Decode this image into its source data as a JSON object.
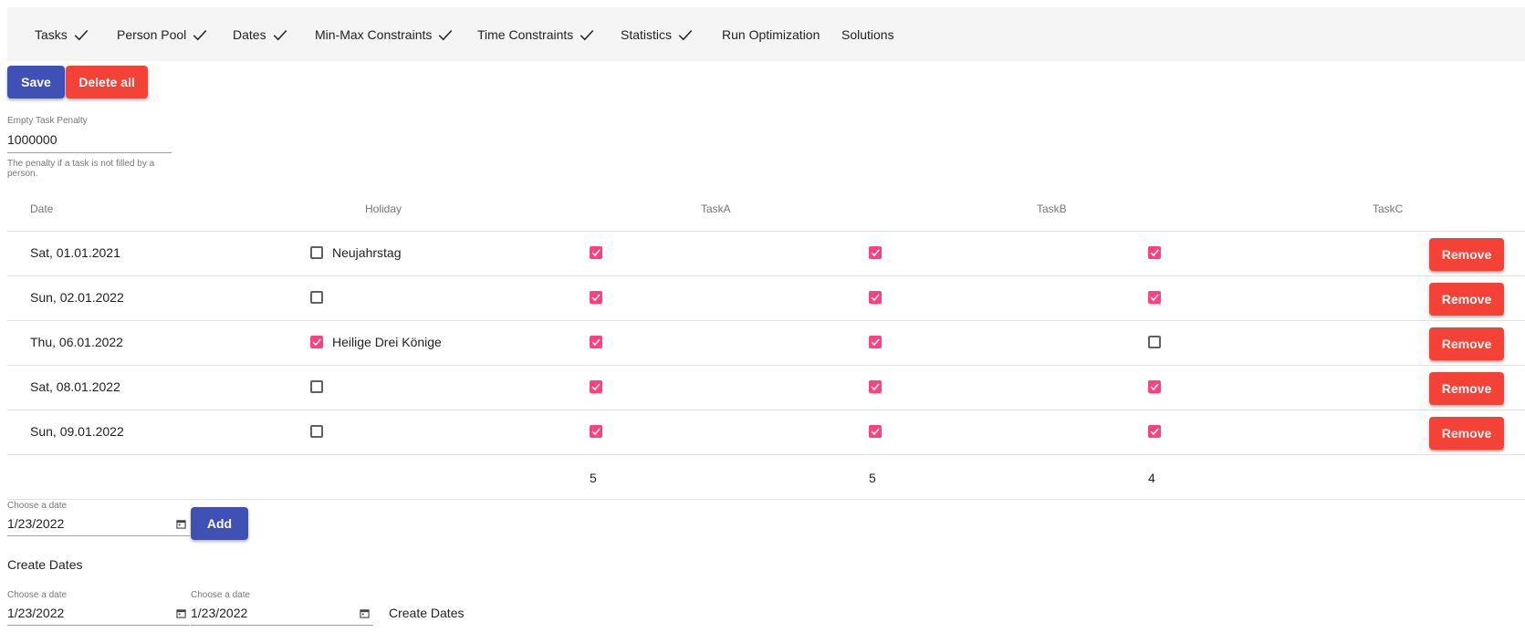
{
  "nav": {
    "items": [
      {
        "label": "Tasks",
        "done": true
      },
      {
        "label": "Person Pool",
        "done": true
      },
      {
        "label": "Dates",
        "done": true
      },
      {
        "label": "Min-Max Constraints",
        "done": true
      },
      {
        "label": "Time Constraints",
        "done": true
      },
      {
        "label": "Statistics",
        "done": true
      },
      {
        "label": "Run Optimization",
        "done": false
      },
      {
        "label": "Solutions",
        "done": false
      }
    ]
  },
  "toolbar": {
    "save_label": "Save",
    "delete_all_label": "Delete all"
  },
  "penalty": {
    "label": "Empty Task Penalty",
    "value": "1000000",
    "hint": "The penalty if a task is not filled by a person."
  },
  "table": {
    "headers": {
      "date": "Date",
      "holiday": "Holiday",
      "task_a": "TaskA",
      "task_b": "TaskB",
      "task_c": "TaskC"
    },
    "rows": [
      {
        "date": "Sat, 01.01.2021",
        "holiday_checked": false,
        "holiday_name": "Neujahrstag",
        "task_a": true,
        "task_b": true,
        "task_c": true
      },
      {
        "date": "Sun, 02.01.2022",
        "holiday_checked": false,
        "holiday_name": "",
        "task_a": true,
        "task_b": true,
        "task_c": true
      },
      {
        "date": "Thu, 06.01.2022",
        "holiday_checked": true,
        "holiday_name": "Heilige Drei Könige",
        "task_a": true,
        "task_b": true,
        "task_c": false
      },
      {
        "date": "Sat, 08.01.2022",
        "holiday_checked": false,
        "holiday_name": "",
        "task_a": true,
        "task_b": true,
        "task_c": true
      },
      {
        "date": "Sun, 09.01.2022",
        "holiday_checked": false,
        "holiday_name": "",
        "task_a": true,
        "task_b": true,
        "task_c": true
      }
    ],
    "remove_label": "Remove",
    "totals": {
      "task_a": "5",
      "task_b": "5",
      "task_c": "4"
    }
  },
  "add_date": {
    "label": "Choose a date",
    "value": "1/23/2022",
    "add_label": "Add"
  },
  "create_dates": {
    "title": "Create Dates",
    "from_label": "Choose a date",
    "from_value": "1/23/2022",
    "to_label": "Choose a date",
    "to_value": "1/23/2022",
    "button_label": "Create Dates"
  },
  "colors": {
    "primary": "#3f51b5",
    "warn": "#f44336",
    "accent": "#ff4081"
  }
}
